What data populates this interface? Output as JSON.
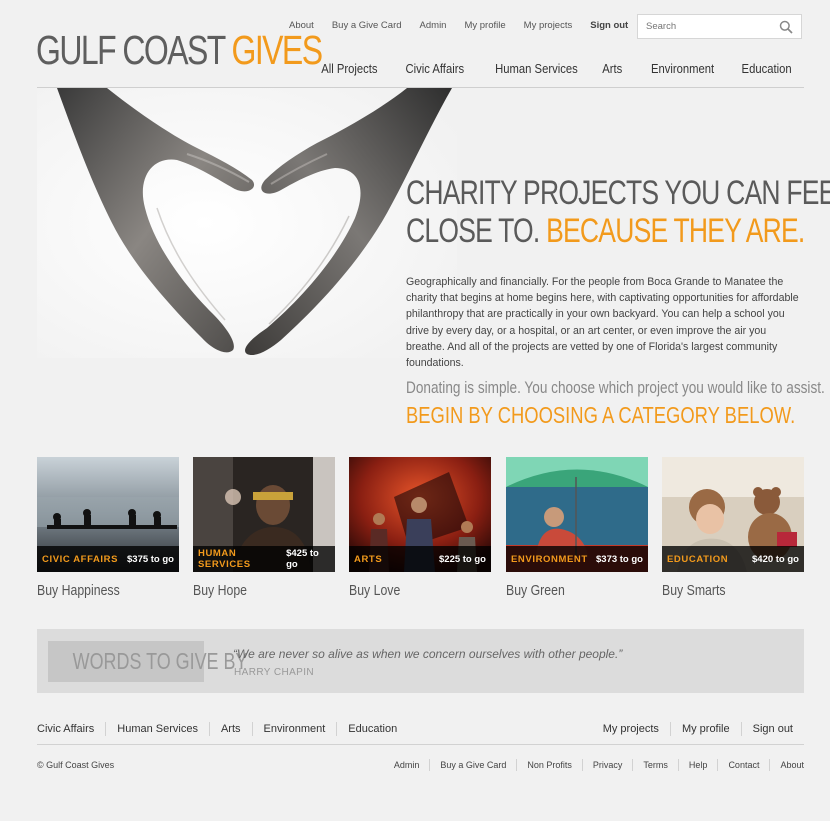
{
  "header": {
    "logo_part1": "GULF COAST",
    "logo_part2": "GIVES",
    "topnav": [
      "About",
      "Buy a Give Card",
      "Admin",
      "My profile",
      "My projects",
      "Sign out"
    ],
    "search_placeholder": "Search",
    "mainnav": [
      "All Projects",
      "Civic Affairs",
      "Human Services",
      "Arts",
      "Environment",
      "Education"
    ]
  },
  "hero": {
    "title_line1": "CHARITY PROJECTS YOU CAN FEEL",
    "title_line2_grey": "CLOSE TO.",
    "title_line2_orange": "BECAUSE THEY ARE.",
    "body": "Geographically and financially. For the people from Boca Grande to Manatee the charity that begins at home begins here, with captivating opportunities for affordable philanthropy that are practically in your own backyard. You can help a school you drive by every day, or a hospital, or an art center, or even improve the air you breathe. And all of the projects are vetted by one of Florida's largest community foundations.",
    "simple": "Donating is simple. You choose which project you would like to assist.",
    "begin": "BEGIN BY CHOOSING A CATEGORY BELOW."
  },
  "categories": [
    {
      "name": "CIVIC AFFAIRS",
      "amount": "$375 to go",
      "cta": "Buy Happiness"
    },
    {
      "name": "HUMAN SERVICES",
      "amount": "$425 to go",
      "cta": "Buy Hope"
    },
    {
      "name": "ARTS",
      "amount": "$225 to go",
      "cta": "Buy Love"
    },
    {
      "name": "ENVIRONMENT",
      "amount": "$373 to go",
      "cta": "Buy Green"
    },
    {
      "name": "EDUCATION",
      "amount": "$420 to go",
      "cta": "Buy Smarts"
    }
  ],
  "words": {
    "label": "WORDS TO GIVE BY",
    "quote": "“We are never so alive as when we concern ourselves with other people.”",
    "author": "HARRY CHAPIN"
  },
  "footer": {
    "left_nav": [
      "Civic Affairs",
      "Human Services",
      "Arts",
      "Environment",
      "Education"
    ],
    "right_nav": [
      "My projects",
      "My profile",
      "Sign out"
    ],
    "copyright": "© Gulf Coast Gives",
    "small_nav": [
      "Admin",
      "Buy a Give Card",
      "Non Profits",
      "Privacy",
      "Terms",
      "Help",
      "Contact",
      "About"
    ]
  },
  "colors": {
    "brand_orange": "#f29a1c",
    "brand_grey": "#5e5e5e"
  }
}
